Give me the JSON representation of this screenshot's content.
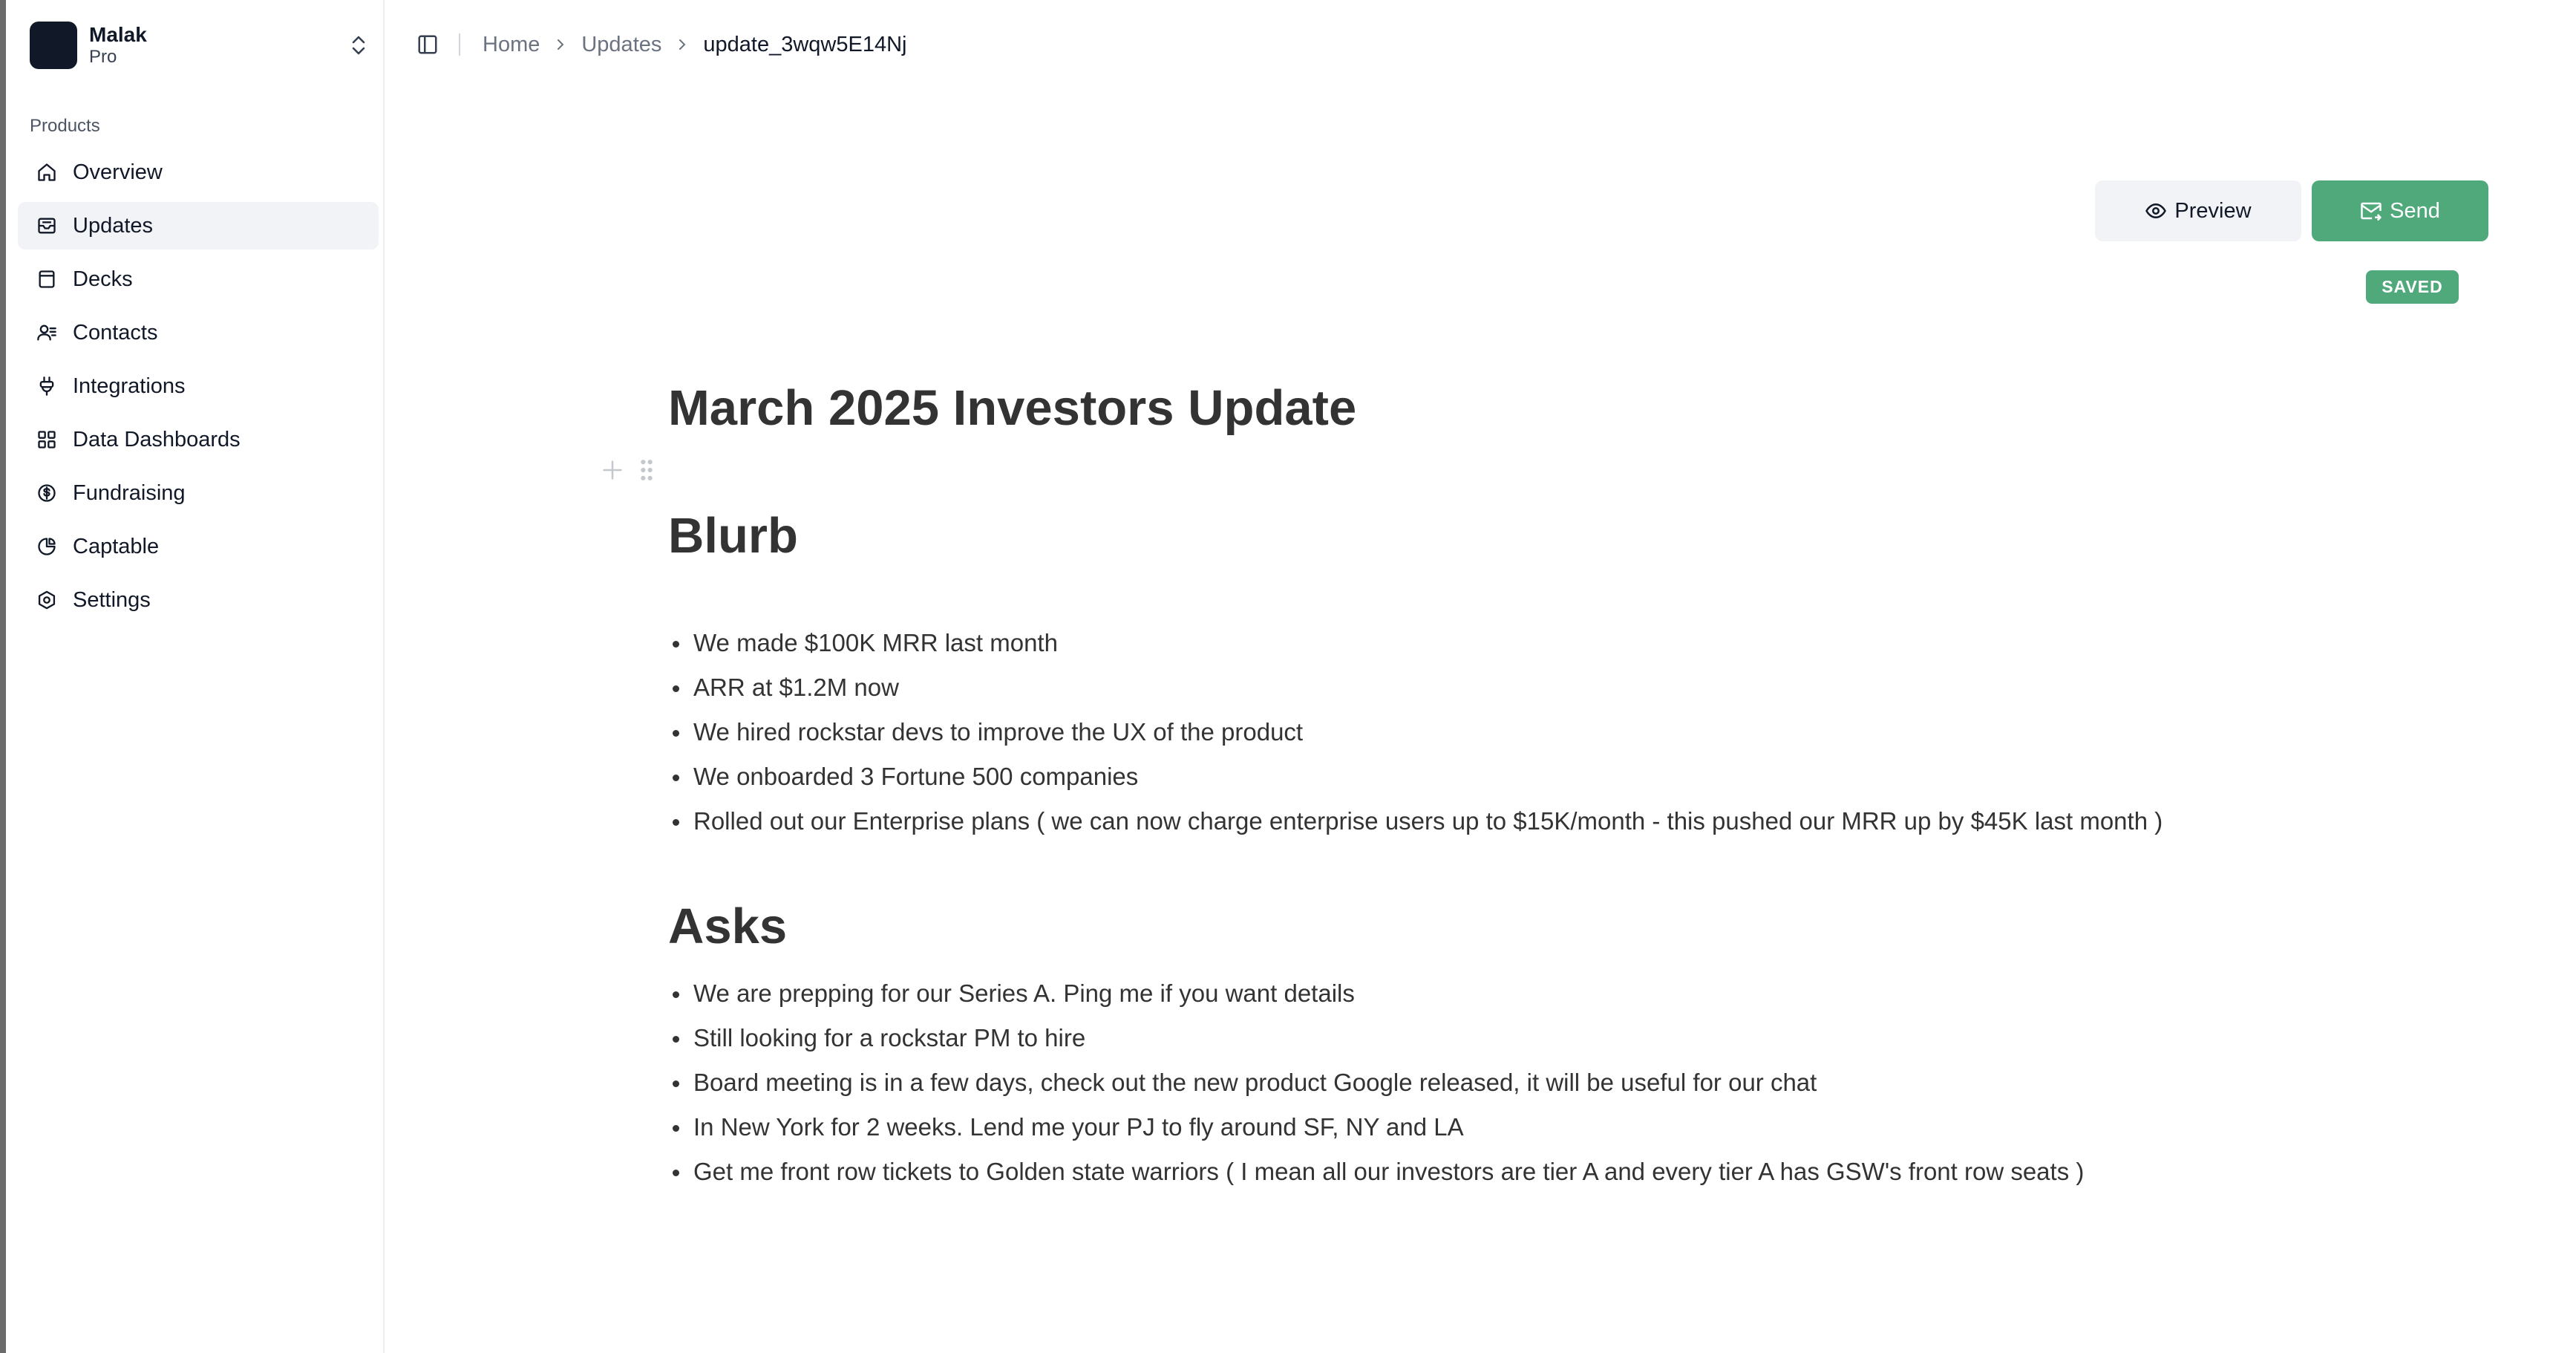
{
  "org": {
    "name": "Malak",
    "plan": "Pro"
  },
  "sidebar": {
    "group_label": "Products",
    "items": [
      {
        "label": "Overview",
        "icon": "home-icon",
        "active": false
      },
      {
        "label": "Updates",
        "icon": "inbox-icon",
        "active": true
      },
      {
        "label": "Decks",
        "icon": "deck-icon",
        "active": false
      },
      {
        "label": "Contacts",
        "icon": "contacts-icon",
        "active": false
      },
      {
        "label": "Integrations",
        "icon": "plug-icon",
        "active": false
      },
      {
        "label": "Data Dashboards",
        "icon": "dashboard-icon",
        "active": false
      },
      {
        "label": "Fundraising",
        "icon": "dollar-circle-icon",
        "active": false
      },
      {
        "label": "Captable",
        "icon": "pie-chart-icon",
        "active": false
      },
      {
        "label": "Settings",
        "icon": "gear-icon",
        "active": false
      }
    ]
  },
  "breadcrumb": {
    "home": "Home",
    "updates": "Updates",
    "current": "update_3wqw5E14Nj"
  },
  "actions": {
    "preview_label": "Preview",
    "send_label": "Send",
    "status_badge": "SAVED"
  },
  "document": {
    "title": "March 2025 Investors Update",
    "sections": [
      {
        "heading": "Blurb",
        "bullets": [
          "We made $100K MRR last month",
          "ARR at $1.2M now",
          "We hired rockstar devs to improve the UX of the product",
          "We onboarded 3 Fortune 500 companies",
          "Rolled out our Enterprise plans ( we can now charge enterprise users up to $15K/month - this pushed our MRR up by $45K last month )"
        ]
      },
      {
        "heading": "Asks",
        "bullets": [
          "We are prepping for our Series A. Ping me if you want details",
          "Still looking for a rockstar PM to hire",
          "Board meeting is in a few days, check out the new product Google released, it will be useful for our chat",
          "In New York for 2 weeks. Lend me your PJ to fly around SF, NY and LA",
          "Get me front row tickets to Golden state warriors ( I mean all our investors are tier A and every tier A has GSW's front row seats )"
        ]
      }
    ]
  },
  "colors": {
    "accent_green": "#4fa97a",
    "active_nav_bg": "#f1f3f6",
    "text_dark": "#333333"
  }
}
